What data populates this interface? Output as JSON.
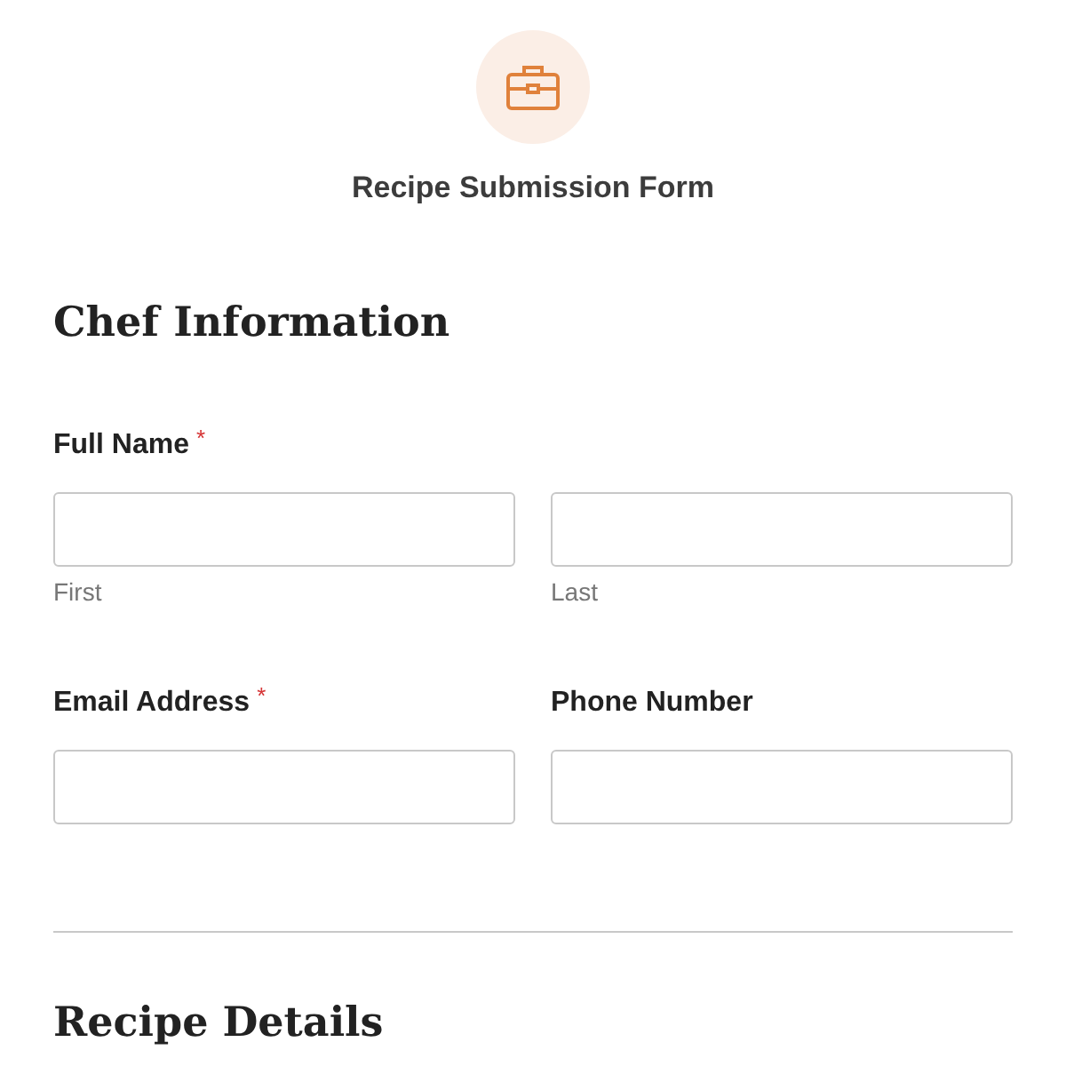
{
  "form": {
    "title": "Recipe Submission Form"
  },
  "sections": [
    {
      "heading": "Chef Information",
      "rows": [
        {
          "kind": "name",
          "label": "Full Name",
          "required_mark": "*",
          "sublabels": [
            "First",
            "Last"
          ]
        },
        {
          "kind": "pair",
          "fields": [
            {
              "label": "Email Address",
              "required_mark": "*"
            },
            {
              "label": "Phone Number"
            }
          ]
        }
      ]
    },
    {
      "heading": "Recipe Details"
    }
  ]
}
